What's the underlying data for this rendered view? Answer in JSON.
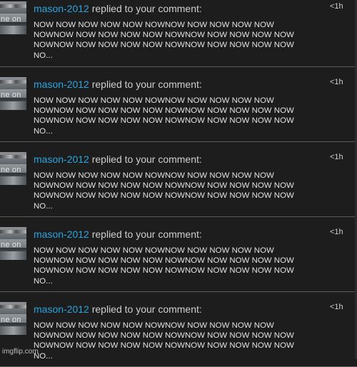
{
  "notifications": [
    {
      "username": "mason-2012",
      "action": "replied to your comment:",
      "time": "<1h",
      "thumb_text": "ne on",
      "text": "NOW NOW NOW NOW NOW NOWNOW NOW NOW NOW NOW\nNOWNOW NOW NOW NOW NOW NOWNOW NOW NOW NOW NOW\nNOWNOW NOW NOW NOW NOW NOWNOW NOW NOW NOW NOW\nNO..."
    },
    {
      "username": "mason-2012",
      "action": "replied to your comment:",
      "time": "<1h",
      "thumb_text": "ne on",
      "text": "NOW NOW NOW NOW NOW NOWNOW NOW NOW NOW NOW\nNOWNOW NOW NOW NOW NOW NOWNOW NOW NOW NOW NOW\nNOWNOW NOW NOW NOW NOW NOWNOW NOW NOW NOW NOW\nNO..."
    },
    {
      "username": "mason-2012",
      "action": "replied to your comment:",
      "time": "<1h",
      "thumb_text": "ne on",
      "text": "NOW NOW NOW NOW NOW NOWNOW NOW NOW NOW NOW\nNOWNOW NOW NOW NOW NOW NOWNOW NOW NOW NOW NOW\nNOWNOW NOW NOW NOW NOW NOWNOW NOW NOW NOW NOW\nNO..."
    },
    {
      "username": "mason-2012",
      "action": "replied to your comment:",
      "time": "<1h",
      "thumb_text": "ne on",
      "text": "NOW NOW NOW NOW NOW NOWNOW NOW NOW NOW NOW\nNOWNOW NOW NOW NOW NOW NOWNOW NOW NOW NOW NOW\nNOWNOW NOW NOW NOW NOW NOWNOW NOW NOW NOW NOW\nNO..."
    },
    {
      "username": "mason-2012",
      "action": "replied to your comment:",
      "time": "<1h",
      "thumb_text": "ne on",
      "text": "NOW NOW NOW NOW NOW NOWNOW NOW NOW NOW NOW\nNOWNOW NOW NOW NOW NOW NOWNOW NOW NOW NOW NOW\nNOWNOW NOW NOW NOW NOW NOWNOW NOW NOW NOW NOW\nNO..."
    }
  ],
  "watermark": "imgflip.com",
  "colors": {
    "background": "#1d1d1d",
    "username": "#2aa5df",
    "text": "#e2e2e2",
    "divider": "#5a5a5a"
  }
}
